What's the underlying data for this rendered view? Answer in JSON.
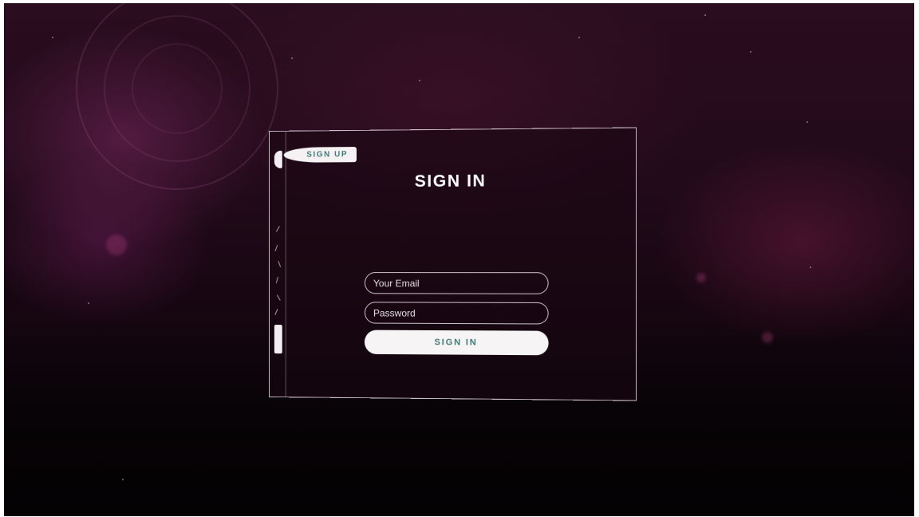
{
  "tabs": {
    "signup_label": "SIGN UP"
  },
  "form": {
    "title": "SIGN IN",
    "email_placeholder": "Your Email",
    "email_value": "",
    "password_placeholder": "Password",
    "password_value": "",
    "submit_label": "SIGN IN"
  },
  "colors": {
    "accent": "#3e7a78",
    "panel_border": "#ebdce6",
    "background_top": "#2a0d1f",
    "background_bottom": "#040203"
  }
}
